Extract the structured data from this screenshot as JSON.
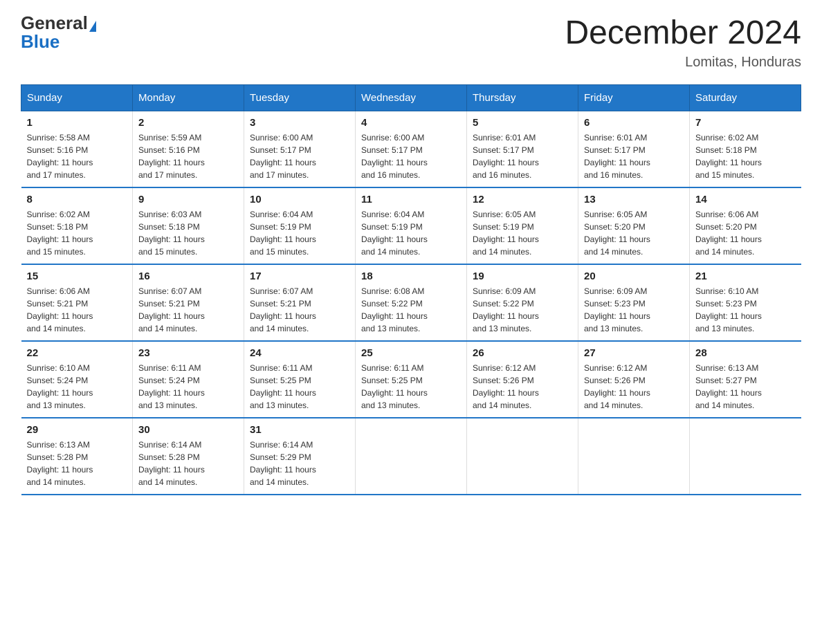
{
  "header": {
    "logo_general": "General",
    "logo_blue": "Blue",
    "title": "December 2024",
    "subtitle": "Lomitas, Honduras"
  },
  "days_of_week": [
    "Sunday",
    "Monday",
    "Tuesday",
    "Wednesday",
    "Thursday",
    "Friday",
    "Saturday"
  ],
  "weeks": [
    [
      {
        "day": "1",
        "sunrise": "5:58 AM",
        "sunset": "5:16 PM",
        "daylight": "11 hours and 17 minutes."
      },
      {
        "day": "2",
        "sunrise": "5:59 AM",
        "sunset": "5:16 PM",
        "daylight": "11 hours and 17 minutes."
      },
      {
        "day": "3",
        "sunrise": "6:00 AM",
        "sunset": "5:17 PM",
        "daylight": "11 hours and 17 minutes."
      },
      {
        "day": "4",
        "sunrise": "6:00 AM",
        "sunset": "5:17 PM",
        "daylight": "11 hours and 16 minutes."
      },
      {
        "day": "5",
        "sunrise": "6:01 AM",
        "sunset": "5:17 PM",
        "daylight": "11 hours and 16 minutes."
      },
      {
        "day": "6",
        "sunrise": "6:01 AM",
        "sunset": "5:17 PM",
        "daylight": "11 hours and 16 minutes."
      },
      {
        "day": "7",
        "sunrise": "6:02 AM",
        "sunset": "5:18 PM",
        "daylight": "11 hours and 15 minutes."
      }
    ],
    [
      {
        "day": "8",
        "sunrise": "6:02 AM",
        "sunset": "5:18 PM",
        "daylight": "11 hours and 15 minutes."
      },
      {
        "day": "9",
        "sunrise": "6:03 AM",
        "sunset": "5:18 PM",
        "daylight": "11 hours and 15 minutes."
      },
      {
        "day": "10",
        "sunrise": "6:04 AM",
        "sunset": "5:19 PM",
        "daylight": "11 hours and 15 minutes."
      },
      {
        "day": "11",
        "sunrise": "6:04 AM",
        "sunset": "5:19 PM",
        "daylight": "11 hours and 14 minutes."
      },
      {
        "day": "12",
        "sunrise": "6:05 AM",
        "sunset": "5:19 PM",
        "daylight": "11 hours and 14 minutes."
      },
      {
        "day": "13",
        "sunrise": "6:05 AM",
        "sunset": "5:20 PM",
        "daylight": "11 hours and 14 minutes."
      },
      {
        "day": "14",
        "sunrise": "6:06 AM",
        "sunset": "5:20 PM",
        "daylight": "11 hours and 14 minutes."
      }
    ],
    [
      {
        "day": "15",
        "sunrise": "6:06 AM",
        "sunset": "5:21 PM",
        "daylight": "11 hours and 14 minutes."
      },
      {
        "day": "16",
        "sunrise": "6:07 AM",
        "sunset": "5:21 PM",
        "daylight": "11 hours and 14 minutes."
      },
      {
        "day": "17",
        "sunrise": "6:07 AM",
        "sunset": "5:21 PM",
        "daylight": "11 hours and 14 minutes."
      },
      {
        "day": "18",
        "sunrise": "6:08 AM",
        "sunset": "5:22 PM",
        "daylight": "11 hours and 13 minutes."
      },
      {
        "day": "19",
        "sunrise": "6:09 AM",
        "sunset": "5:22 PM",
        "daylight": "11 hours and 13 minutes."
      },
      {
        "day": "20",
        "sunrise": "6:09 AM",
        "sunset": "5:23 PM",
        "daylight": "11 hours and 13 minutes."
      },
      {
        "day": "21",
        "sunrise": "6:10 AM",
        "sunset": "5:23 PM",
        "daylight": "11 hours and 13 minutes."
      }
    ],
    [
      {
        "day": "22",
        "sunrise": "6:10 AM",
        "sunset": "5:24 PM",
        "daylight": "11 hours and 13 minutes."
      },
      {
        "day": "23",
        "sunrise": "6:11 AM",
        "sunset": "5:24 PM",
        "daylight": "11 hours and 13 minutes."
      },
      {
        "day": "24",
        "sunrise": "6:11 AM",
        "sunset": "5:25 PM",
        "daylight": "11 hours and 13 minutes."
      },
      {
        "day": "25",
        "sunrise": "6:11 AM",
        "sunset": "5:25 PM",
        "daylight": "11 hours and 13 minutes."
      },
      {
        "day": "26",
        "sunrise": "6:12 AM",
        "sunset": "5:26 PM",
        "daylight": "11 hours and 14 minutes."
      },
      {
        "day": "27",
        "sunrise": "6:12 AM",
        "sunset": "5:26 PM",
        "daylight": "11 hours and 14 minutes."
      },
      {
        "day": "28",
        "sunrise": "6:13 AM",
        "sunset": "5:27 PM",
        "daylight": "11 hours and 14 minutes."
      }
    ],
    [
      {
        "day": "29",
        "sunrise": "6:13 AM",
        "sunset": "5:28 PM",
        "daylight": "11 hours and 14 minutes."
      },
      {
        "day": "30",
        "sunrise": "6:14 AM",
        "sunset": "5:28 PM",
        "daylight": "11 hours and 14 minutes."
      },
      {
        "day": "31",
        "sunrise": "6:14 AM",
        "sunset": "5:29 PM",
        "daylight": "11 hours and 14 minutes."
      },
      null,
      null,
      null,
      null
    ]
  ],
  "labels": {
    "sunrise": "Sunrise:",
    "sunset": "Sunset:",
    "daylight": "Daylight:"
  }
}
